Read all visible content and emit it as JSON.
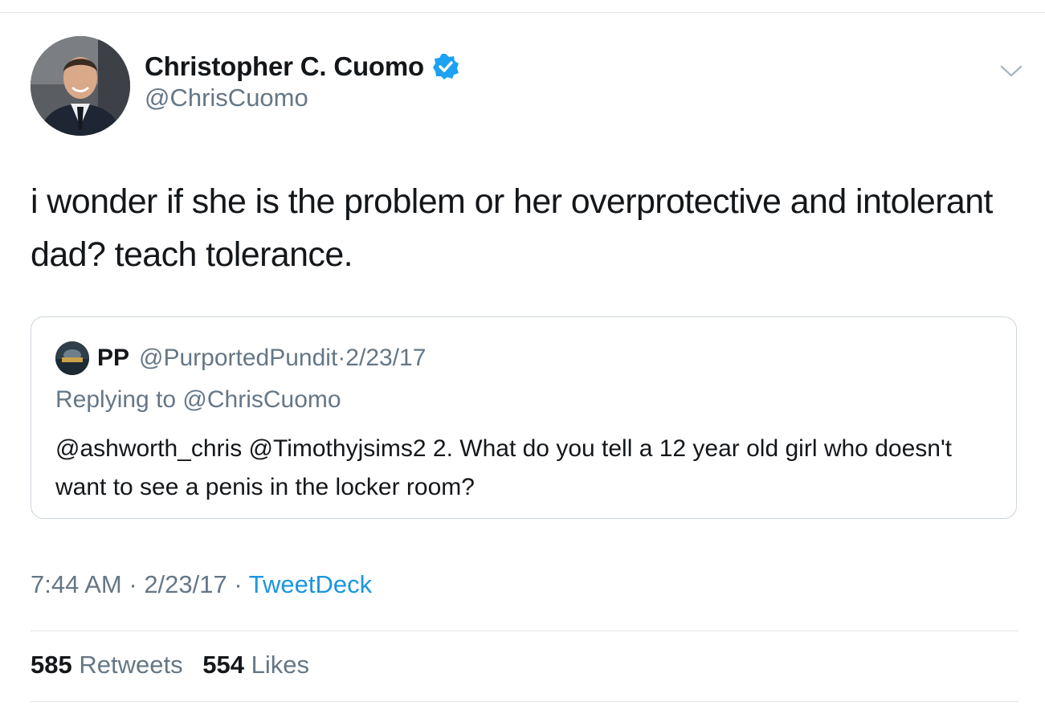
{
  "author": {
    "name": "Christopher C. Cuomo",
    "handle": "@ChrisCuomo",
    "verified": true,
    "verified_color": "#1da1f2"
  },
  "tweet": {
    "text": "i wonder if she is the problem or her overprotective and intolerant dad? teach tolerance.",
    "time": "7:44 AM",
    "date": "2/23/17",
    "source": "TweetDeck",
    "separator": " · "
  },
  "quoted_tweet": {
    "name": "PP",
    "handle": "@PurportedPundit",
    "date": "2/23/17",
    "replying_to": "Replying to @ChrisCuomo",
    "text": "@ashworth_chris @Timothyjsims2 2. What do you tell a 12 year old girl who doesn't want to see a penis in the locker room?"
  },
  "stats": {
    "retweets_count": "585",
    "retweets_label": "Retweets",
    "likes_count": "554",
    "likes_label": "Likes"
  },
  "icons": {
    "menu": "chevron-down-icon",
    "verified": "verified-badge-icon"
  },
  "colors": {
    "text_primary": "#14171a",
    "text_secondary": "#657786",
    "link": "#1b95e0",
    "border": "#ccd6dd"
  }
}
